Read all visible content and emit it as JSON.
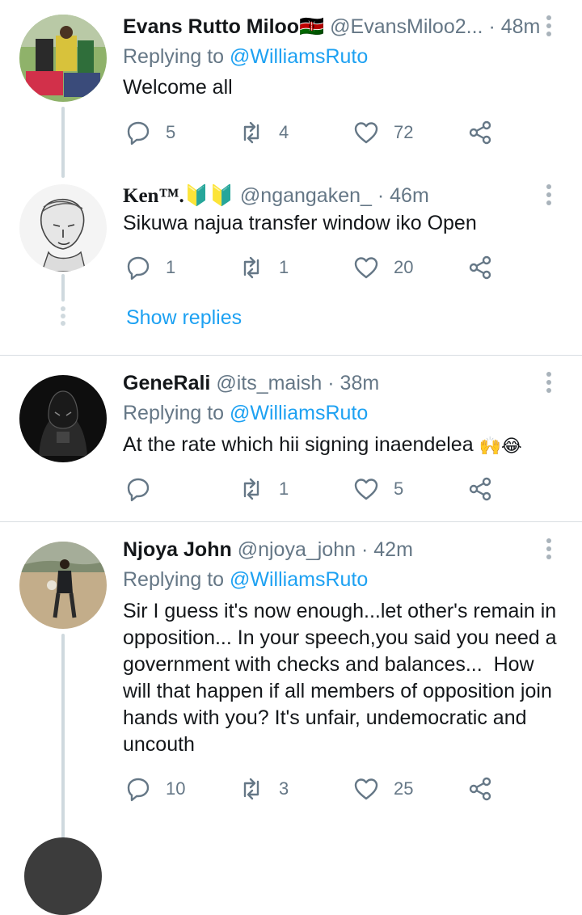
{
  "tweets": [
    {
      "name": "Evans Rutto Miloo🇰🇪",
      "handle": "@EvansMiloo2...",
      "time": "· 48m",
      "replying_prefix": "Replying to",
      "replying_to": "@WilliamsRuto",
      "text": "Welcome all",
      "replies": "5",
      "retweets": "4",
      "likes": "72"
    },
    {
      "name": "Ken™.🔰🔰",
      "handle": "@ngangaken_",
      "time": "· 46m",
      "text": "Sikuwa najua transfer window iko Open",
      "replies": "1",
      "retweets": "1",
      "likes": "20"
    },
    {
      "name": "GeneRali",
      "handle": "@its_maish",
      "time": "· 38m",
      "replying_prefix": "Replying to",
      "replying_to": "@WilliamsRuto",
      "text": "At the rate which hii signing inaendelea",
      "text_emoji": "🙌😂",
      "replies": "",
      "retweets": "1",
      "likes": "5"
    },
    {
      "name": "Njoya John",
      "handle": "@njoya_john",
      "time": "· 42m",
      "replying_prefix": "Replying to",
      "replying_to": "@WilliamsRuto",
      "text_lines": [
        "Sir I guess it's now enough...let other's remain in",
        "opposition... In your speech,you said you need a",
        "government with checks and balances...  How",
        "will that happen if all members of opposition join",
        "hands with you? It's unfair, undemocratic and",
        "uncouth"
      ],
      "replies": "10",
      "retweets": "3",
      "likes": "25"
    }
  ],
  "show_replies": "Show replies",
  "colors": {
    "link": "#1da1f2",
    "secondary": "#657786",
    "text": "#14171a",
    "thread": "#cfd9de"
  }
}
